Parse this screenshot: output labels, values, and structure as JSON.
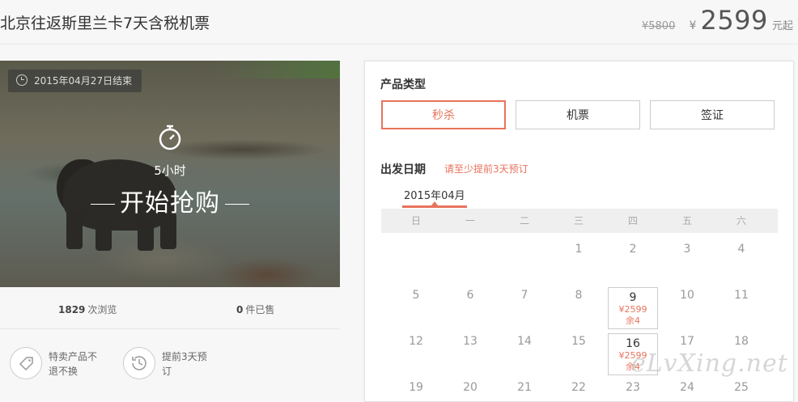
{
  "header": {
    "title": "北京往返斯里兰卡7天含税机票",
    "old_price": "¥5800",
    "currency": "¥",
    "price": "2599",
    "price_suffix": "元起"
  },
  "hero": {
    "end_tag": "2015年04月27日结束",
    "countdown": "5小时",
    "start_label": "开始抢购"
  },
  "stats": {
    "views_count": "1829",
    "views_label": "次浏览",
    "sold_count": "0",
    "sold_label": "件已售"
  },
  "features": [
    {
      "icon": "tag-icon",
      "text": "特卖产品不退不换"
    },
    {
      "icon": "history-clock-icon",
      "text": "提前3天预订"
    }
  ],
  "panel": {
    "type_title": "产品类型",
    "types": [
      "秒杀",
      "机票",
      "签证"
    ],
    "active_type": "秒杀",
    "date_title": "出发日期",
    "date_hint": "请至少提前3天预订",
    "month": "2015年04月",
    "weekdays": [
      "日",
      "一",
      "二",
      "三",
      "四",
      "五",
      "六"
    ],
    "days": [
      {
        "d": "1",
        "col": 3,
        "row": 0
      },
      {
        "d": "2",
        "col": 4,
        "row": 0
      },
      {
        "d": "3",
        "col": 5,
        "row": 0
      },
      {
        "d": "4",
        "col": 6,
        "row": 0
      },
      {
        "d": "5",
        "col": 0,
        "row": 1
      },
      {
        "d": "6",
        "col": 1,
        "row": 1
      },
      {
        "d": "7",
        "col": 2,
        "row": 1
      },
      {
        "d": "8",
        "col": 3,
        "row": 1
      },
      {
        "d": "9",
        "col": 4,
        "row": 1,
        "price": "¥2599",
        "remain": "余4"
      },
      {
        "d": "10",
        "col": 5,
        "row": 1
      },
      {
        "d": "11",
        "col": 6,
        "row": 1
      },
      {
        "d": "12",
        "col": 0,
        "row": 2
      },
      {
        "d": "13",
        "col": 1,
        "row": 2
      },
      {
        "d": "14",
        "col": 2,
        "row": 2
      },
      {
        "d": "15",
        "col": 3,
        "row": 2
      },
      {
        "d": "16",
        "col": 4,
        "row": 2,
        "price": "¥2599",
        "remain": "余4"
      },
      {
        "d": "17",
        "col": 5,
        "row": 2
      },
      {
        "d": "18",
        "col": 6,
        "row": 2
      },
      {
        "d": "19",
        "col": 0,
        "row": 3
      },
      {
        "d": "20",
        "col": 1,
        "row": 3
      },
      {
        "d": "21",
        "col": 2,
        "row": 3
      },
      {
        "d": "22",
        "col": 3,
        "row": 3
      },
      {
        "d": "23",
        "col": 4,
        "row": 3
      },
      {
        "d": "24",
        "col": 5,
        "row": 3
      },
      {
        "d": "25",
        "col": 6,
        "row": 3
      }
    ]
  },
  "watermark": "eLvXing.net",
  "colors": {
    "accent": "#e8735c"
  }
}
